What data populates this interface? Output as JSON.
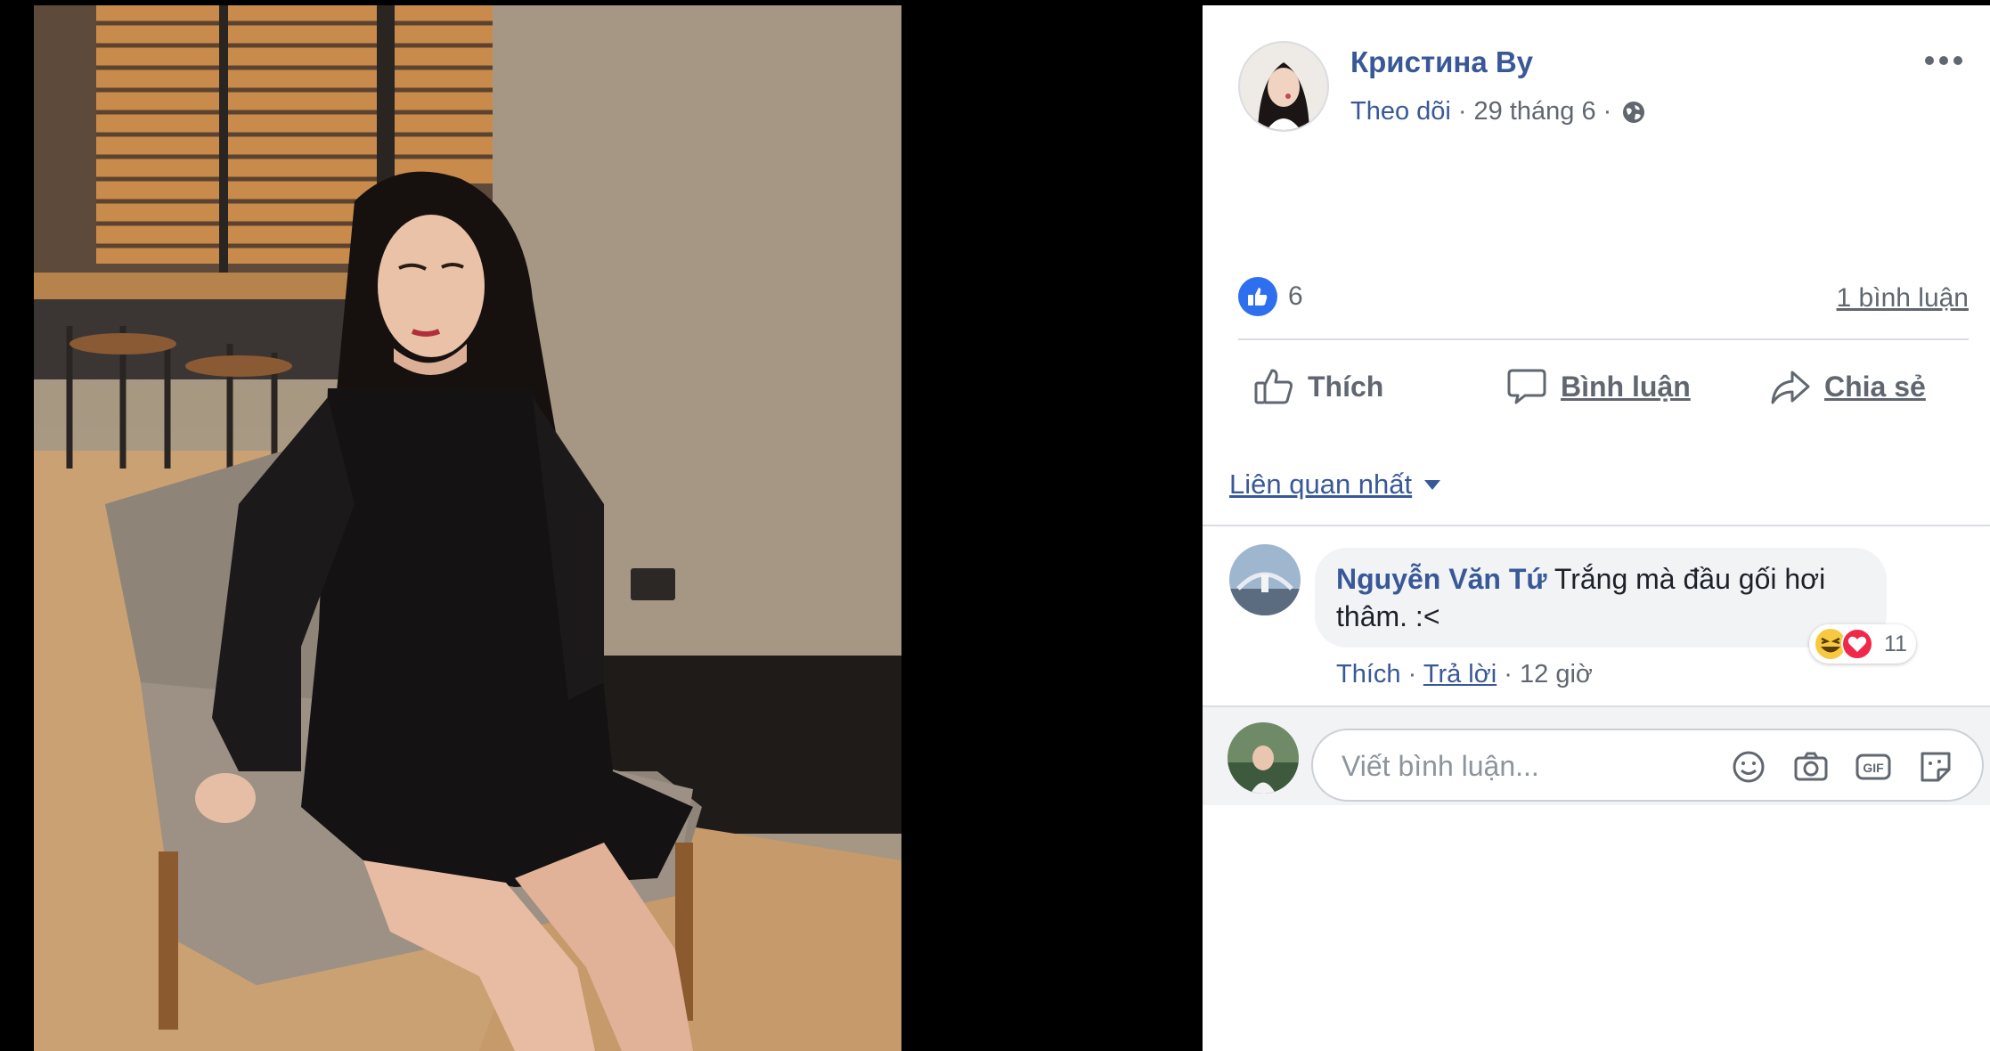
{
  "post": {
    "author": "Кристина Ву",
    "follow_label": "Theo dõi",
    "date": "29 tháng 6",
    "dot": "·",
    "like_count": "6",
    "comment_count": "1 bình luận"
  },
  "actions": {
    "like": "Thích",
    "comment": "Bình luận",
    "share": "Chia sẻ"
  },
  "sort": {
    "label": "Liên quan nhất"
  },
  "comments": [
    {
      "author": "Nguyễn Văn Tứ",
      "text": "Trắng mà đầu gối hơi thâm. :<",
      "reaction_count": "11",
      "like_label": "Thích",
      "reply_label": "Trả lời",
      "time": "12 giờ"
    }
  ],
  "composer": {
    "placeholder": "Viết bình luận..."
  },
  "icons": {
    "privacy": "globe-icon",
    "more": "more-icon",
    "like_badge": "thumbs-up-icon",
    "emoji": "emoji-icon",
    "camera": "camera-icon",
    "gif": "gif-icon",
    "sticker": "sticker-icon"
  },
  "colors": {
    "link_blue": "#385898",
    "like_blue": "#2e6ff0",
    "bubble_gray": "#f2f3f5",
    "divider": "#dadde1"
  }
}
